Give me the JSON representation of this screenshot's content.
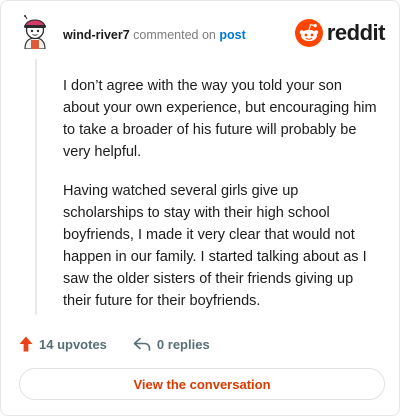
{
  "header": {
    "username": "wind-river7",
    "action_text": "commented on",
    "post_link_text": "post",
    "brand_name": "reddit"
  },
  "comment": {
    "paragraphs": [
      "I don’t agree with the way you told your son about your own experience, but encouraging him to take a broader of his future will probably be very helpful.",
      "Having watched several girls give up scholarships to stay with their high school boyfriends, I made it very clear that would not happen in our family. I started talking about as I saw the older sisters of their friends giving up their future for their boyfriends."
    ]
  },
  "actions": {
    "upvotes_label": "14 upvotes",
    "replies_label": "0 replies"
  },
  "cta": {
    "label": "View the conversation"
  },
  "colors": {
    "brand": "#ff4500",
    "upvote_arrow": "#e8431a",
    "link": "#0079d3",
    "cta_text": "#d93a00"
  },
  "icons": {
    "avatar": "user-avatar-icon",
    "brand": "reddit-logo-icon",
    "upvote": "upvote-arrow-icon",
    "reply": "reply-arrow-icon"
  }
}
